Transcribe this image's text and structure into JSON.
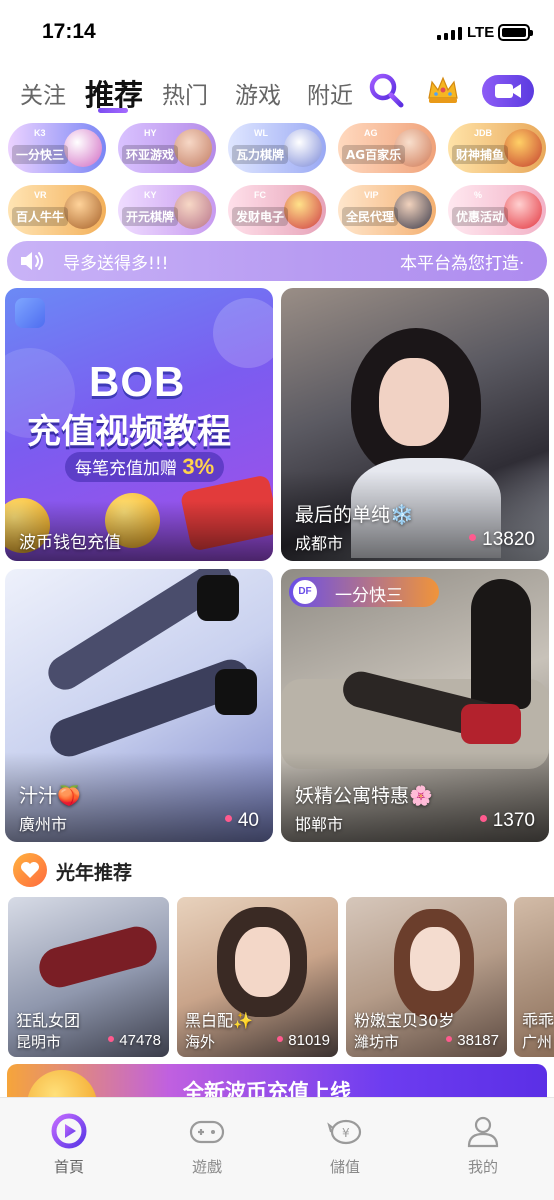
{
  "status_bar": {
    "time": "17:14",
    "network": "LTE"
  },
  "top_tabs": [
    {
      "label": "关注",
      "active": false
    },
    {
      "label": "推荐",
      "active": true
    },
    {
      "label": "热门",
      "active": false
    },
    {
      "label": "游戏",
      "active": false
    },
    {
      "label": "附近",
      "active": false
    }
  ],
  "top_icons": {
    "search": "search-icon",
    "crown": "crown-icon",
    "video": "video-camera-icon"
  },
  "games": [
    {
      "label": "一分快三",
      "color": "#7a86f5"
    },
    {
      "label": "环亚游戏",
      "color": "#b58be8"
    },
    {
      "label": "瓦力棋牌",
      "color": "#9aa9f4"
    },
    {
      "label": "AG百家乐",
      "color": "#f0a27a"
    },
    {
      "label": "财神捕鱼",
      "color": "#e8a85a"
    },
    {
      "label": "百人牛牛",
      "color": "#f3b05a"
    },
    {
      "label": "开元棋牌",
      "color": "#c79af0"
    },
    {
      "label": "发财电子",
      "color": "#e6a2b8"
    },
    {
      "label": "全民代理",
      "color": "#f4b071"
    },
    {
      "label": "优惠活动",
      "color": "#f2b1c6"
    }
  ],
  "marquee": {
    "text_left": "导多送得多!!!",
    "text_right": "本平台為您打造·"
  },
  "cards": [
    {
      "type": "promo",
      "promo_brand": "BOB",
      "promo_title": "充值视频教程",
      "promo_tag_text": "每笔充值加赠",
      "promo_tag_value": "3%",
      "title": "波币钱包充值"
    },
    {
      "title": "最后的单纯❄️",
      "city": "成都市",
      "count": "13820"
    },
    {
      "title": "汁汁🍑",
      "city": "廣州市",
      "count": "40"
    },
    {
      "title": "妖精公寓特惠🌸",
      "city": "邯郸市",
      "count": "1370",
      "chip": "一分快三"
    }
  ],
  "section": {
    "title": "光年推荐"
  },
  "recommend": [
    {
      "title": "狂乱女团",
      "city": "昆明市",
      "count": "47478"
    },
    {
      "title": "黑白配✨",
      "city": "海外",
      "count": "81019"
    },
    {
      "title": "粉嫩宝贝30岁",
      "city": "濰坊市",
      "count": "38187"
    },
    {
      "title": "乖乖",
      "city": "广州",
      "count": ""
    }
  ],
  "banner": {
    "text": "全新波币充值上线"
  },
  "bottom_nav": [
    {
      "label": "首頁",
      "icon": "home-icon",
      "active": true
    },
    {
      "label": "遊戲",
      "icon": "gamepad-icon",
      "active": false
    },
    {
      "label": "儲值",
      "icon": "piggy-bank-icon",
      "active": false
    },
    {
      "label": "我的",
      "icon": "user-icon",
      "active": false
    }
  ],
  "colors": {
    "accent": "#7b4cf0",
    "count_dot": "#ff5a8e"
  }
}
